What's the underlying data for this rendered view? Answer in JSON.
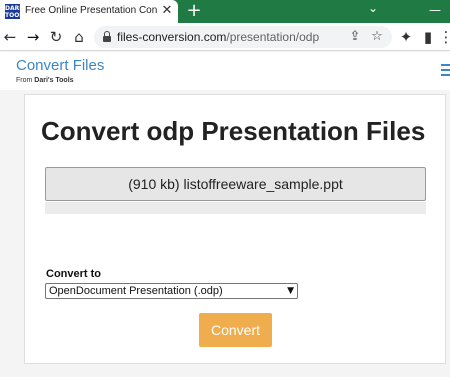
{
  "browser": {
    "tab": {
      "favicon_text": "DARIS TOOLS",
      "title": "Free Online Presentation Convert",
      "close": "✕"
    },
    "new_tab": "+",
    "window_controls": {
      "chevron": "⌄",
      "minimize": "—"
    },
    "toolbar": {
      "back": "←",
      "forward": "→",
      "reload": "↻",
      "home": "⌂",
      "url_domain": "files-conversion.com",
      "url_path": "/presentation/odp",
      "share": "⇪",
      "bookmark": "☆",
      "extensions": "✦",
      "sidepanel": "▮",
      "menu": "⋮"
    }
  },
  "site": {
    "brand_title": "Convert Files",
    "brand_sub_prefix": "From ",
    "brand_sub_name": "Dari's Tools"
  },
  "main": {
    "heading": "Convert odp Presentation Files",
    "file_label": "(910 kb) listoffreeware_sample.ppt",
    "convert_to_label": "Convert to",
    "select_value": "OpenDocument Presentation (.odp)",
    "convert_button": "Convert"
  },
  "colors": {
    "tabstrip": "#1f7a43",
    "brand": "#3b86c6",
    "convert_button": "#f0ad4e"
  }
}
